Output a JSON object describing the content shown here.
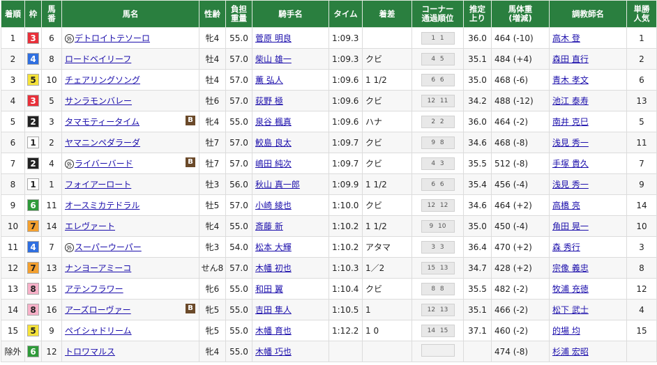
{
  "headers": {
    "order": "着順",
    "waku": "枠",
    "umaban": "馬\n番",
    "horse": "馬名",
    "sexage": "性齢",
    "weight": "負担\n重量",
    "jockey": "騎手名",
    "time": "タイム",
    "margin": "着差",
    "corner": "コーナー\n通過順位",
    "last3f": "推定\n上り",
    "bodyweight": "馬体重\n(増減)",
    "trainer": "調教師名",
    "odds_rank": "単勝\n人気"
  },
  "waku_colors": {
    "1": {
      "bg": "#ffffff",
      "fg": "#222222"
    },
    "2": {
      "bg": "#222222",
      "fg": "#ffffff"
    },
    "3": {
      "bg": "#e8303a",
      "fg": "#ffffff"
    },
    "4": {
      "bg": "#2f6fe0",
      "fg": "#ffffff"
    },
    "5": {
      "bg": "#f5e23a",
      "fg": "#222222"
    },
    "6": {
      "bg": "#2f9a3a",
      "fg": "#ffffff"
    },
    "7": {
      "bg": "#f3a030",
      "fg": "#222222"
    },
    "8": {
      "bg": "#f7b0c8",
      "fg": "#222222"
    }
  },
  "foreign_mark": "外",
  "blinker_mark": "B",
  "rows": [
    {
      "order": "1",
      "waku": "3",
      "umaban": "6",
      "foreign": true,
      "horse": "デトロイトテソーロ",
      "blinker": false,
      "sexage": "牝4",
      "weight": "55.0",
      "jockey": "菅原 明良",
      "time": "1:09.3",
      "margin": "",
      "corner": "1 1",
      "last3f": "36.0",
      "bodyweight": "464 (-10)",
      "trainer": "高木 登",
      "odds_rank": "1"
    },
    {
      "order": "2",
      "waku": "4",
      "umaban": "8",
      "foreign": false,
      "horse": "ロードベイリーフ",
      "blinker": false,
      "sexage": "牡4",
      "weight": "57.0",
      "jockey": "柴山 雄一",
      "time": "1:09.3",
      "margin": "クビ",
      "corner": "4 5",
      "last3f": "35.1",
      "bodyweight": "484 (+4)",
      "trainer": "森田 直行",
      "odds_rank": "2"
    },
    {
      "order": "3",
      "waku": "5",
      "umaban": "10",
      "foreign": false,
      "horse": "チェアリングソング",
      "blinker": false,
      "sexage": "牡4",
      "weight": "57.0",
      "jockey": "薫 弘人",
      "time": "1:09.6",
      "margin": "1 1/2",
      "corner": "6 6",
      "last3f": "35.0",
      "bodyweight": "468 (-6)",
      "trainer": "青木 孝文",
      "odds_rank": "6"
    },
    {
      "order": "4",
      "waku": "3",
      "umaban": "5",
      "foreign": false,
      "horse": "サンラモンバレー",
      "blinker": false,
      "sexage": "牡6",
      "weight": "57.0",
      "jockey": "荻野 極",
      "time": "1:09.6",
      "margin": "クビ",
      "corner": "12 11",
      "last3f": "34.2",
      "bodyweight": "488 (-12)",
      "trainer": "池江 泰寿",
      "odds_rank": "13"
    },
    {
      "order": "5",
      "waku": "2",
      "umaban": "3",
      "foreign": false,
      "horse": "タマモティータイム",
      "blinker": true,
      "sexage": "牝4",
      "weight": "55.0",
      "jockey": "泉谷 楓真",
      "time": "1:09.6",
      "margin": "ハナ",
      "corner": "2 2",
      "last3f": "36.0",
      "bodyweight": "464 (-2)",
      "trainer": "南井 克巳",
      "odds_rank": "5"
    },
    {
      "order": "6",
      "waku": "1",
      "umaban": "2",
      "foreign": false,
      "horse": "ヤマニンペダラーダ",
      "blinker": false,
      "sexage": "牡7",
      "weight": "57.0",
      "jockey": "鮫島 良太",
      "time": "1:09.7",
      "margin": "クビ",
      "corner": "9 8",
      "last3f": "34.6",
      "bodyweight": "468 (-8)",
      "trainer": "浅見 秀一",
      "odds_rank": "11"
    },
    {
      "order": "7",
      "waku": "2",
      "umaban": "4",
      "foreign": true,
      "horse": "ライバーバード",
      "blinker": true,
      "sexage": "牡7",
      "weight": "57.0",
      "jockey": "嶋田 純次",
      "time": "1:09.7",
      "margin": "クビ",
      "corner": "4 3",
      "last3f": "35.5",
      "bodyweight": "512 (-8)",
      "trainer": "手塚 貴久",
      "odds_rank": "7"
    },
    {
      "order": "8",
      "waku": "1",
      "umaban": "1",
      "foreign": false,
      "horse": "フォイアーロート",
      "blinker": false,
      "sexage": "牡3",
      "weight": "56.0",
      "jockey": "秋山 真一郎",
      "time": "1:09.9",
      "margin": "1 1/2",
      "corner": "6 6",
      "last3f": "35.4",
      "bodyweight": "456 (-4)",
      "trainer": "浅見 秀一",
      "odds_rank": "9"
    },
    {
      "order": "9",
      "waku": "6",
      "umaban": "11",
      "foreign": false,
      "horse": "オースミカテドラル",
      "blinker": false,
      "sexage": "牡5",
      "weight": "57.0",
      "jockey": "小崎 綾也",
      "time": "1:10.0",
      "margin": "クビ",
      "corner": "12 12",
      "last3f": "34.6",
      "bodyweight": "464 (+2)",
      "trainer": "高橋 亮",
      "odds_rank": "14"
    },
    {
      "order": "10",
      "waku": "7",
      "umaban": "14",
      "foreign": false,
      "horse": "エレヴァート",
      "blinker": false,
      "sexage": "牝4",
      "weight": "55.0",
      "jockey": "斎藤 新",
      "time": "1:10.2",
      "margin": "1 1/2",
      "corner": "9 10",
      "last3f": "35.0",
      "bodyweight": "450 (-4)",
      "trainer": "角田 晃一",
      "odds_rank": "10"
    },
    {
      "order": "11",
      "waku": "4",
      "umaban": "7",
      "foreign": true,
      "horse": "スーパーウーパー",
      "blinker": false,
      "sexage": "牝3",
      "weight": "54.0",
      "jockey": "松本 大輝",
      "time": "1:10.2",
      "margin": "アタマ",
      "corner": "3 3",
      "last3f": "36.4",
      "bodyweight": "470 (+2)",
      "trainer": "森 秀行",
      "odds_rank": "3"
    },
    {
      "order": "12",
      "waku": "7",
      "umaban": "13",
      "foreign": false,
      "horse": "ナンヨーアミーコ",
      "blinker": false,
      "sexage": "せん8",
      "weight": "57.0",
      "jockey": "木幡 初也",
      "time": "1:10.3",
      "margin": "1／2",
      "corner": "15 13",
      "last3f": "34.7",
      "bodyweight": "428 (+2)",
      "trainer": "宗像 義忠",
      "odds_rank": "8"
    },
    {
      "order": "13",
      "waku": "8",
      "umaban": "15",
      "foreign": false,
      "horse": "アテンフラワー",
      "blinker": false,
      "sexage": "牝6",
      "weight": "55.0",
      "jockey": "和田 翼",
      "time": "1:10.4",
      "margin": "クビ",
      "corner": "8 8",
      "last3f": "35.5",
      "bodyweight": "482 (-2)",
      "trainer": "牧浦 充徳",
      "odds_rank": "12"
    },
    {
      "order": "14",
      "waku": "8",
      "umaban": "16",
      "foreign": false,
      "horse": "アーズローヴァー",
      "blinker": true,
      "sexage": "牝5",
      "weight": "55.0",
      "jockey": "吉田 隼人",
      "time": "1:10.5",
      "margin": "1",
      "corner": "12 13",
      "last3f": "35.1",
      "bodyweight": "466 (-2)",
      "trainer": "松下 武士",
      "odds_rank": "4"
    },
    {
      "order": "15",
      "waku": "5",
      "umaban": "9",
      "foreign": false,
      "horse": "ペイシャドリーム",
      "blinker": false,
      "sexage": "牝5",
      "weight": "55.0",
      "jockey": "木幡 育也",
      "time": "1:12.2",
      "margin": "1 0",
      "corner": "14 15",
      "last3f": "37.1",
      "bodyweight": "460 (-2)",
      "trainer": "的場 均",
      "odds_rank": "15"
    },
    {
      "order": "除外",
      "waku": "6",
      "umaban": "12",
      "foreign": false,
      "horse": "トロワマルス",
      "blinker": false,
      "sexage": "牝4",
      "weight": "55.0",
      "jockey": "木幡 巧也",
      "time": "",
      "margin": "",
      "corner": "",
      "last3f": "",
      "bodyweight": "474 (-8)",
      "trainer": "杉浦 宏昭",
      "odds_rank": ""
    }
  ]
}
